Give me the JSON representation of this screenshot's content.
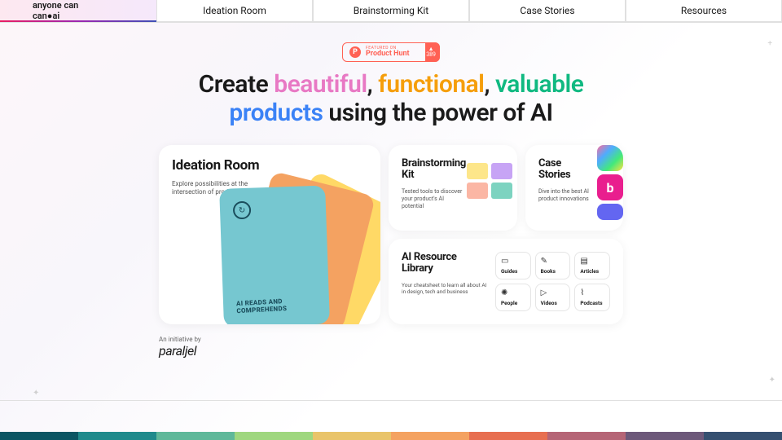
{
  "brand": {
    "name": "anyone can",
    "suffix": "ai"
  },
  "nav": [
    "Ideation Room",
    "Brainstorming Kit",
    "Case Stories",
    "Resources"
  ],
  "ph": {
    "top": "FEATURED ON",
    "name": "Product Hunt",
    "count": "389"
  },
  "hero": {
    "w1": "Create ",
    "w2": "beautiful",
    "c1": ", ",
    "w3": "functional",
    "c2": ", ",
    "w4": "valuable",
    "w5": "products",
    "w6": " using the power of AI"
  },
  "cards": {
    "ideation": {
      "title": "Ideation Room",
      "desc": "Explore possibilities at the intersection of product and AI",
      "cardText": "AI READS AND COMPREHENDS"
    },
    "bkit": {
      "title": "Brainstorming Kit",
      "desc": "Tested tools to discover your product's AI potential"
    },
    "cstory": {
      "title": "Case Stories",
      "desc": "Dive into the best AI product innovations",
      "logo_b": "b"
    },
    "reslib": {
      "title": "AI Resource Library",
      "desc": "Your cheatsheet to learn all about AI in design, tech and business",
      "items": [
        {
          "icon": "▭",
          "label": "Guides"
        },
        {
          "icon": "✎",
          "label": "Books"
        },
        {
          "icon": "▤",
          "label": "Articles"
        },
        {
          "icon": "✺",
          "label": "People"
        },
        {
          "icon": "▷",
          "label": "Videos"
        },
        {
          "icon": "⌇",
          "label": "Podcasts"
        }
      ]
    }
  },
  "footer": {
    "initiative": "An initiative by",
    "brand": "paraljel"
  },
  "rainbow": [
    "#0b5563",
    "#1f8a8c",
    "#5fb89a",
    "#9fd77f",
    "#e9c46a",
    "#f4a261",
    "#e76f51",
    "#b56576",
    "#6d597a",
    "#355070"
  ]
}
